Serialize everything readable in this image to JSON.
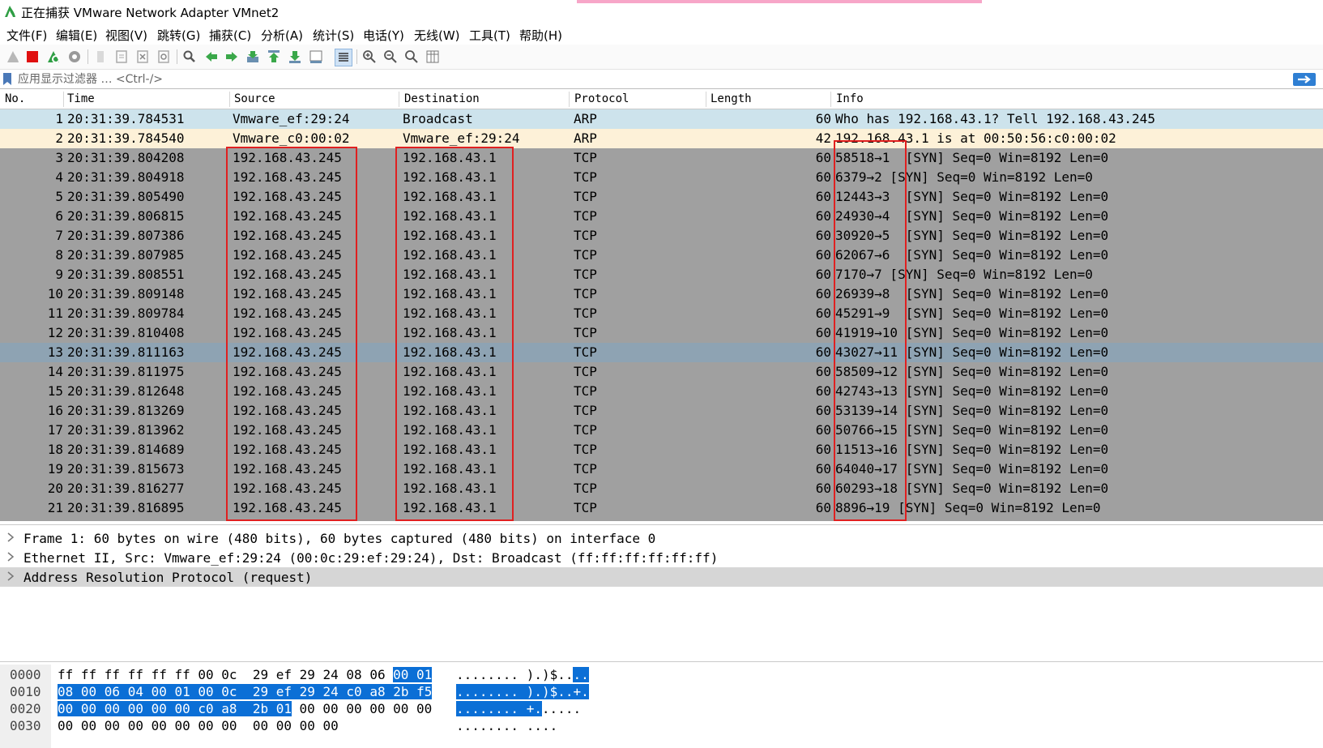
{
  "window": {
    "title": "正在捕获 VMware Network Adapter VMnet2"
  },
  "menu": [
    "文件(F)",
    "编辑(E)",
    "视图(V)",
    "跳转(G)",
    "捕获(C)",
    "分析(A)",
    "统计(S)",
    "电话(Y)",
    "无线(W)",
    "工具(T)",
    "帮助(H)"
  ],
  "toolbar": {
    "icons": [
      "shark-fin-start-icon",
      "stop-icon",
      "restart-icon",
      "options-gear-icon",
      "open-file-icon",
      "save-file-icon",
      "close-file-icon",
      "reload-icon",
      "find-icon",
      "back-arrow-icon",
      "forward-arrow-icon",
      "goto-packet-icon",
      "first-packet-icon",
      "last-packet-icon",
      "autoscroll-icon",
      "colorize-icon",
      "zoom-in-icon",
      "zoom-out-icon",
      "zoom-normal-icon",
      "resize-columns-icon"
    ]
  },
  "filter": {
    "placeholder": "应用显示过滤器 … <Ctrl-/>"
  },
  "columns": [
    "No.",
    "Time",
    "Source",
    "Destination",
    "Protocol",
    "Length",
    "Info"
  ],
  "packets": [
    {
      "no": "1",
      "time": "20:31:39.784531",
      "src": "Vmware_ef:29:24",
      "dst": "Broadcast",
      "proto": "ARP",
      "len": "60",
      "info": "Who has 192.168.43.1? Tell 192.168.43.245",
      "style": "arp1"
    },
    {
      "no": "2",
      "time": "20:31:39.784540",
      "src": "Vmware_c0:00:02",
      "dst": "Vmware_ef:29:24",
      "proto": "ARP",
      "len": "42",
      "info": "192.168.43.1 is at 00:50:56:c0:00:02",
      "style": "arp2"
    },
    {
      "no": "3",
      "time": "20:31:39.804208",
      "src": "192.168.43.245",
      "dst": "192.168.43.1",
      "proto": "TCP",
      "len": "60",
      "info": "58518→1  [SYN] Seq=0 Win=8192 Len=0",
      "style": "tcp"
    },
    {
      "no": "4",
      "time": "20:31:39.804918",
      "src": "192.168.43.245",
      "dst": "192.168.43.1",
      "proto": "TCP",
      "len": "60",
      "info": "6379→2 [SYN] Seq=0 Win=8192 Len=0",
      "style": "tcp"
    },
    {
      "no": "5",
      "time": "20:31:39.805490",
      "src": "192.168.43.245",
      "dst": "192.168.43.1",
      "proto": "TCP",
      "len": "60",
      "info": "12443→3  [SYN] Seq=0 Win=8192 Len=0",
      "style": "tcp"
    },
    {
      "no": "6",
      "time": "20:31:39.806815",
      "src": "192.168.43.245",
      "dst": "192.168.43.1",
      "proto": "TCP",
      "len": "60",
      "info": "24930→4  [SYN] Seq=0 Win=8192 Len=0",
      "style": "tcp"
    },
    {
      "no": "7",
      "time": "20:31:39.807386",
      "src": "192.168.43.245",
      "dst": "192.168.43.1",
      "proto": "TCP",
      "len": "60",
      "info": "30920→5  [SYN] Seq=0 Win=8192 Len=0",
      "style": "tcp"
    },
    {
      "no": "8",
      "time": "20:31:39.807985",
      "src": "192.168.43.245",
      "dst": "192.168.43.1",
      "proto": "TCP",
      "len": "60",
      "info": "62067→6  [SYN] Seq=0 Win=8192 Len=0",
      "style": "tcp"
    },
    {
      "no": "9",
      "time": "20:31:39.808551",
      "src": "192.168.43.245",
      "dst": "192.168.43.1",
      "proto": "TCP",
      "len": "60",
      "info": "7170→7 [SYN] Seq=0 Win=8192 Len=0",
      "style": "tcp"
    },
    {
      "no": "10",
      "time": "20:31:39.809148",
      "src": "192.168.43.245",
      "dst": "192.168.43.1",
      "proto": "TCP",
      "len": "60",
      "info": "26939→8  [SYN] Seq=0 Win=8192 Len=0",
      "style": "tcp"
    },
    {
      "no": "11",
      "time": "20:31:39.809784",
      "src": "192.168.43.245",
      "dst": "192.168.43.1",
      "proto": "TCP",
      "len": "60",
      "info": "45291→9  [SYN] Seq=0 Win=8192 Len=0",
      "style": "tcp"
    },
    {
      "no": "12",
      "time": "20:31:39.810408",
      "src": "192.168.43.245",
      "dst": "192.168.43.1",
      "proto": "TCP",
      "len": "60",
      "info": "41919→10 [SYN] Seq=0 Win=8192 Len=0",
      "style": "tcp"
    },
    {
      "no": "13",
      "time": "20:31:39.811163",
      "src": "192.168.43.245",
      "dst": "192.168.43.1",
      "proto": "TCP",
      "len": "60",
      "info": "43027→11 [SYN] Seq=0 Win=8192 Len=0",
      "style": "tcpsel"
    },
    {
      "no": "14",
      "time": "20:31:39.811975",
      "src": "192.168.43.245",
      "dst": "192.168.43.1",
      "proto": "TCP",
      "len": "60",
      "info": "58509→12 [SYN] Seq=0 Win=8192 Len=0",
      "style": "tcp"
    },
    {
      "no": "15",
      "time": "20:31:39.812648",
      "src": "192.168.43.245",
      "dst": "192.168.43.1",
      "proto": "TCP",
      "len": "60",
      "info": "42743→13 [SYN] Seq=0 Win=8192 Len=0",
      "style": "tcp"
    },
    {
      "no": "16",
      "time": "20:31:39.813269",
      "src": "192.168.43.245",
      "dst": "192.168.43.1",
      "proto": "TCP",
      "len": "60",
      "info": "53139→14 [SYN] Seq=0 Win=8192 Len=0",
      "style": "tcp"
    },
    {
      "no": "17",
      "time": "20:31:39.813962",
      "src": "192.168.43.245",
      "dst": "192.168.43.1",
      "proto": "TCP",
      "len": "60",
      "info": "50766→15 [SYN] Seq=0 Win=8192 Len=0",
      "style": "tcp"
    },
    {
      "no": "18",
      "time": "20:31:39.814689",
      "src": "192.168.43.245",
      "dst": "192.168.43.1",
      "proto": "TCP",
      "len": "60",
      "info": "11513→16 [SYN] Seq=0 Win=8192 Len=0",
      "style": "tcp"
    },
    {
      "no": "19",
      "time": "20:31:39.815673",
      "src": "192.168.43.245",
      "dst": "192.168.43.1",
      "proto": "TCP",
      "len": "60",
      "info": "64040→17 [SYN] Seq=0 Win=8192 Len=0",
      "style": "tcp"
    },
    {
      "no": "20",
      "time": "20:31:39.816277",
      "src": "192.168.43.245",
      "dst": "192.168.43.1",
      "proto": "TCP",
      "len": "60",
      "info": "60293→18 [SYN] Seq=0 Win=8192 Len=0",
      "style": "tcp"
    },
    {
      "no": "21",
      "time": "20:31:39.816895",
      "src": "192.168.43.245",
      "dst": "192.168.43.1",
      "proto": "TCP",
      "len": "60",
      "info": "8896→19 [SYN] Seq=0 Win=8192 Len=0",
      "style": "tcp"
    }
  ],
  "details": [
    {
      "text": "Frame 1: 60 bytes on wire (480 bits), 60 bytes captured (480 bits) on interface 0",
      "selected": false
    },
    {
      "text": "Ethernet II, Src: Vmware_ef:29:24 (00:0c:29:ef:29:24), Dst: Broadcast (ff:ff:ff:ff:ff:ff)",
      "selected": false
    },
    {
      "text": "Address Resolution Protocol (request)",
      "selected": true
    }
  ],
  "hex": [
    {
      "offset": "0000",
      "bytes_plain": "ff ff ff ff ff ff 00 0c  29 ef 29 24 08 06 ",
      "bytes_hl": "00 01",
      "bytes_tail": "",
      "ascii_plain": "........ ).)$..",
      "ascii_hl": "..",
      "ascii_tail": ""
    },
    {
      "offset": "0010",
      "bytes_plain": "",
      "bytes_hl": "08 00 06 04 00 01 00 0c  29 ef 29 24 c0 a8 2b f5",
      "bytes_tail": "",
      "ascii_plain": "",
      "ascii_hl": "........ ).)$..+.",
      "ascii_tail": ""
    },
    {
      "offset": "0020",
      "bytes_plain": "",
      "bytes_hl": "00 00 00 00 00 00 c0 a8  2b 01",
      "bytes_tail": " 00 00 00 00 00 00",
      "ascii_plain": "",
      "ascii_hl": "........ +.",
      "ascii_tail": "....."
    },
    {
      "offset": "0030",
      "bytes_plain": "00 00 00 00 00 00 00 00  00 00 00 00",
      "bytes_hl": "",
      "bytes_tail": "",
      "ascii_plain": "........ ....",
      "ascii_hl": "",
      "ascii_tail": ""
    }
  ],
  "colors": {
    "arp1": "#cde3ec",
    "arp2": "#fdf1d8",
    "tcp": "#a0a0a0",
    "tcpsel": "#8ea3b3",
    "highlight": "#0b6fd6",
    "redbox": "#e02020"
  }
}
